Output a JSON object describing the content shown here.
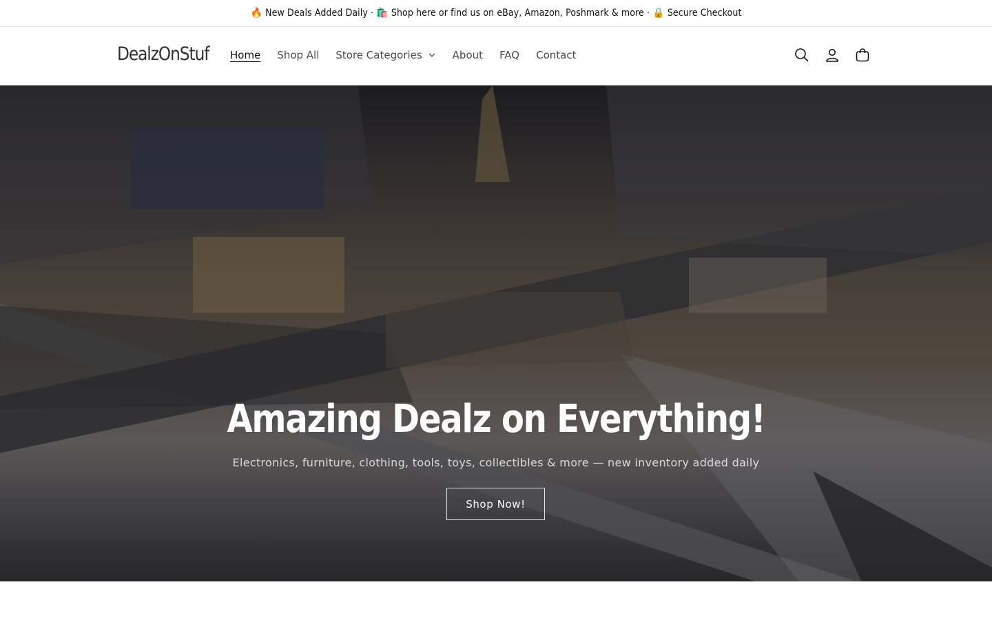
{
  "announcement": {
    "text": "🔥 New Deals Added Daily · 🛍️ Shop here or find us on eBay, Amazon, Poshmark & more · 🔒 Secure Checkout"
  },
  "header": {
    "logo": "DealzOnStuf",
    "nav": [
      {
        "label": "Home",
        "active": true
      },
      {
        "label": "Shop All"
      },
      {
        "label": "Store Categories",
        "has_dropdown": true
      },
      {
        "label": "About"
      },
      {
        "label": "FAQ"
      },
      {
        "label": "Contact"
      }
    ],
    "icons": [
      "search-icon",
      "account-icon",
      "cart-icon"
    ]
  },
  "hero": {
    "title": "Amazing Dealz on Everything!",
    "subtitle": "Electronics, furniture, clothing, tools, toys, collectibles & more — new inventory added daily",
    "button_label": "Shop Now!"
  },
  "colors": {
    "text": "#121212",
    "nav_text": "#4b4b4b",
    "border": "#e6e6e6"
  }
}
